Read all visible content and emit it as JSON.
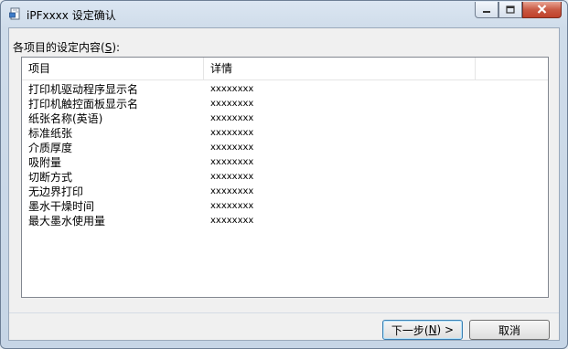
{
  "window": {
    "title": "iPFxxxx  设定确认",
    "icon": "printer-doc-icon",
    "controls": {
      "minimize_icon": "minimize-icon",
      "maximize_icon": "maximize-icon",
      "close_icon": "close-icon"
    }
  },
  "content": {
    "group_label_prefix": "各项目的设定内容(",
    "group_label_mnemonic": "S",
    "group_label_suffix": "):"
  },
  "list": {
    "columns": [
      "项目",
      "详情",
      ""
    ],
    "rows": [
      {
        "item": "打印机驱动程序显示名",
        "detail": "xxxxxxxx"
      },
      {
        "item": "打印机触控面板显示名",
        "detail": "xxxxxxxx"
      },
      {
        "item": "纸张名称(英语)",
        "detail": "xxxxxxxx"
      },
      {
        "item": "标准纸张",
        "detail": "xxxxxxxx"
      },
      {
        "item": "介质厚度",
        "detail": "xxxxxxxx"
      },
      {
        "item": "吸附量",
        "detail": "xxxxxxxx"
      },
      {
        "item": "切断方式",
        "detail": "xxxxxxxx"
      },
      {
        "item": "无边界打印",
        "detail": "xxxxxxxx"
      },
      {
        "item": "墨水干燥时间",
        "detail": "xxxxxxxx"
      },
      {
        "item": "最大墨水使用量",
        "detail": "xxxxxxxx"
      }
    ]
  },
  "buttons": {
    "next_prefix": "下一步(",
    "next_mnemonic": "N",
    "next_suffix": ") >",
    "cancel": "取消"
  }
}
